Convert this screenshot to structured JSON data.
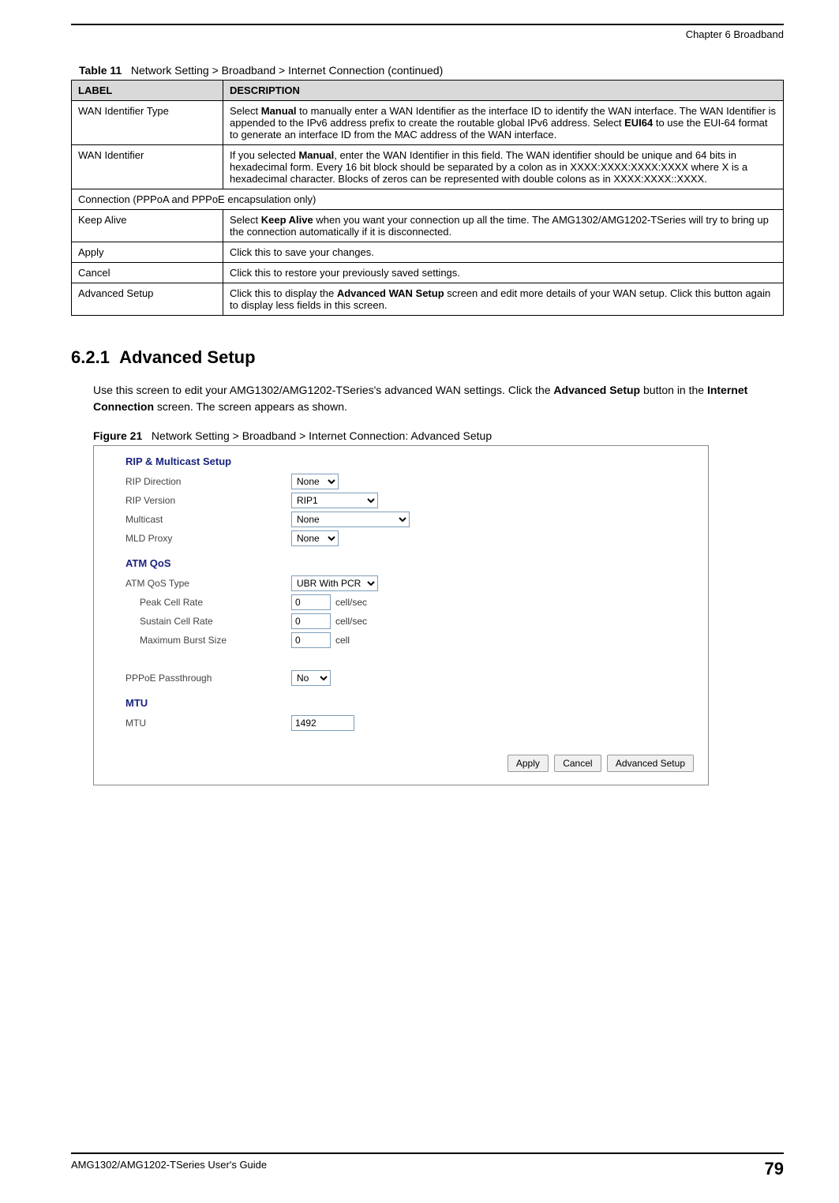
{
  "header": {
    "chapter": "Chapter 6 Broadband"
  },
  "table_caption": {
    "label": "Table 11",
    "text": "Network Setting > Broadband > Internet Connection (continued)"
  },
  "table": {
    "head": {
      "c1": "LABEL",
      "c2": "DESCRIPTION"
    },
    "rows": [
      {
        "label": "WAN Identifier Type",
        "desc_pre": "Select ",
        "desc_b1": "Manual",
        "desc_mid": " to manually enter a WAN Identifier as the interface ID to identify the WAN interface. The WAN Identifier is appended to the IPv6 address prefix to create the routable global IPv6 address. Select ",
        "desc_b2": "EUI64",
        "desc_post": " to use the EUI-64 format to generate an interface ID from the MAC address of the WAN interface."
      },
      {
        "label": "WAN Identifier",
        "desc_pre": "If you selected ",
        "desc_b1": "Manual",
        "desc_mid": ", enter the WAN Identifier in this field. The WAN identifier should be unique and 64 bits in hexadecimal form. Every 16 bit block should be separated by a colon as in XXXX:XXXX:XXXX:XXXX where X is a hexadecimal character. Blocks of zeros can be represented with double colons as in XXXX:XXXX::XXXX.",
        "desc_b2": "",
        "desc_post": ""
      },
      {
        "span": true,
        "label": "Connection (PPPoA and PPPoE encapsulation only)"
      },
      {
        "label": "Keep Alive",
        "desc_pre": "Select ",
        "desc_b1": "Keep Alive",
        "desc_mid": " when you want your connection up all the time. The AMG1302/AMG1202-TSeries will try to bring up the connection automatically if it is disconnected.",
        "desc_b2": "",
        "desc_post": ""
      },
      {
        "label": "Apply",
        "desc_pre": "Click this to save your changes.",
        "desc_b1": "",
        "desc_mid": "",
        "desc_b2": "",
        "desc_post": ""
      },
      {
        "label": "Cancel",
        "desc_pre": "Click this to restore your previously saved settings.",
        "desc_b1": "",
        "desc_mid": "",
        "desc_b2": "",
        "desc_post": ""
      },
      {
        "label": "Advanced Setup",
        "desc_pre": "Click this to display the ",
        "desc_b1": "Advanced WAN Setup",
        "desc_mid": " screen and edit more details of your WAN setup. Click this button again to display less fields in this screen.",
        "desc_b2": "",
        "desc_post": ""
      }
    ]
  },
  "section": {
    "number": "6.2.1",
    "title": "Advanced Setup",
    "para_pre": "Use this screen to edit your AMG1302/AMG1202-TSeries's advanced WAN settings. Click the ",
    "para_b1": "Advanced Setup",
    "para_mid": " button in the ",
    "para_b2": "Internet Connection",
    "para_post": " screen. The screen appears as shown."
  },
  "figure_caption": {
    "label": "Figure 21",
    "text": "Network Setting > Broadband > Internet Connection: Advanced Setup"
  },
  "screenshot": {
    "group1": "RIP & Multicast Setup",
    "rip_direction": {
      "label": "RIP Direction",
      "value": "None"
    },
    "rip_version": {
      "label": "RIP Version",
      "value": "RIP1"
    },
    "multicast": {
      "label": "Multicast",
      "value": "None"
    },
    "mld_proxy": {
      "label": "MLD Proxy",
      "value": "None"
    },
    "group2": "ATM QoS",
    "atm_type": {
      "label": "ATM QoS Type",
      "value": "UBR With PCR"
    },
    "pcr": {
      "label": "Peak Cell Rate",
      "value": "0",
      "unit": "cell/sec"
    },
    "scr": {
      "label": "Sustain Cell Rate",
      "value": "0",
      "unit": "cell/sec"
    },
    "mbs": {
      "label": "Maximum Burst Size",
      "value": "0",
      "unit": "cell"
    },
    "pppoe": {
      "label": "PPPoE Passthrough",
      "value": "No"
    },
    "group3": "MTU",
    "mtu": {
      "label": "MTU",
      "value": "1492"
    },
    "buttons": {
      "apply": "Apply",
      "cancel": "Cancel",
      "adv": "Advanced Setup"
    }
  },
  "footer": {
    "guide": "AMG1302/AMG1202-TSeries User's Guide",
    "page": "79"
  }
}
